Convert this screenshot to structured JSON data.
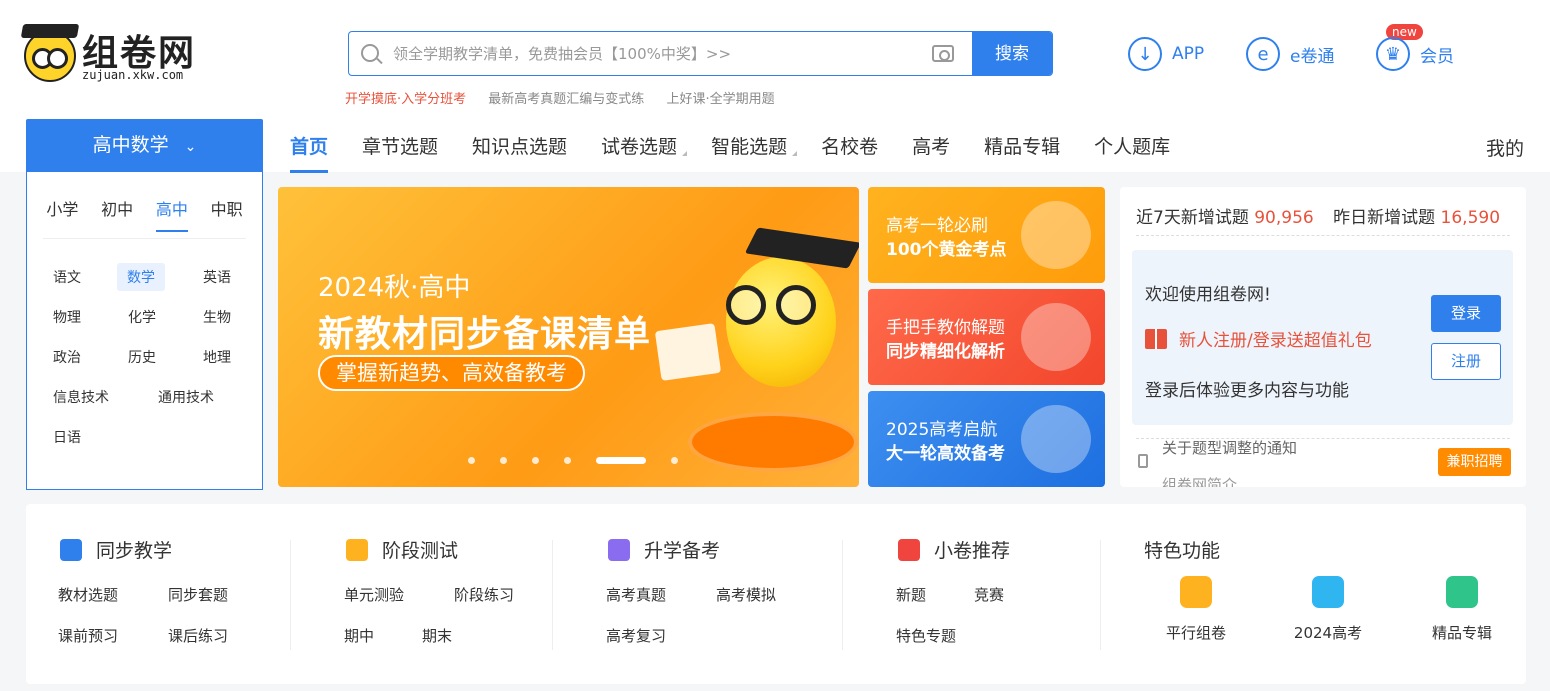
{
  "logo": {
    "text": "组卷网",
    "sub": "zujuan.xkw.com"
  },
  "search": {
    "placeholder": "领全学期教学清单，免费抽会员【100%中奖】>>",
    "button": "搜索"
  },
  "hot_links": [
    "开学摸底·入学分班考",
    "最新高考真题汇编与变式练",
    "上好课·全学期用题"
  ],
  "top_links": {
    "app": "APP",
    "ejuan": "e卷通",
    "ejuan_icon": "e",
    "new_badge": "new",
    "member": "会员"
  },
  "subject_button": "高中数学",
  "nav": [
    "首页",
    "章节选题",
    "知识点选题",
    "试卷选题",
    "智能选题",
    "名校卷",
    "高考",
    "精品专辑",
    "个人题库"
  ],
  "nav_my": "我的",
  "levels": [
    "小学",
    "初中",
    "高中",
    "中职"
  ],
  "subjects": [
    "语文",
    "数学",
    "英语",
    "物理",
    "化学",
    "生物",
    "政治",
    "历史",
    "地理",
    "信息技术",
    "通用技术",
    "日语"
  ],
  "banner": {
    "title1": "2024秋·高中",
    "title2": "新教材同步备课清单",
    "pill": "掌握新趋势、高效备教考"
  },
  "side_cards": [
    {
      "line1": "高考一轮必刷",
      "line2": "100个黄金考点"
    },
    {
      "line1": "手把手教你解题",
      "line2": "同步精细化解析"
    },
    {
      "line1": "2025高考启航",
      "line2": "大一轮高效备考"
    }
  ],
  "stats": {
    "week_label": "近7天新增试题",
    "week_value": "90,956",
    "yesterday_label": "昨日新增试题",
    "yesterday_value": "16,590"
  },
  "welcome": {
    "greeting": "欢迎使用组卷网!",
    "gift": "新人注册/登录送超值礼包",
    "hint": "登录后体验更多内容与功能",
    "login": "登录",
    "register": "注册"
  },
  "notice": {
    "line1": "关于题型调整的通知",
    "line2": "组卷网简介",
    "job": "兼职招聘"
  },
  "columns": [
    {
      "title": "同步教学",
      "links": [
        "教材选题",
        "同步套题",
        "课前预习",
        "课后练习"
      ]
    },
    {
      "title": "阶段测试",
      "links": [
        "单元测验",
        "阶段练习",
        "期中",
        "期末"
      ]
    },
    {
      "title": "升学备考",
      "links": [
        "高考真题",
        "高考模拟",
        "高考复习"
      ]
    },
    {
      "title": "小卷推荐",
      "links": [
        "新题",
        "竞赛",
        "特色专题"
      ]
    }
  ],
  "features": {
    "title": "特色功能",
    "items": [
      "平行组卷",
      "2024高考",
      "精品专辑"
    ]
  },
  "colors": {
    "primary": "#2f80ed",
    "accent_red": "#e8523b",
    "orange": "#ff8b00"
  }
}
